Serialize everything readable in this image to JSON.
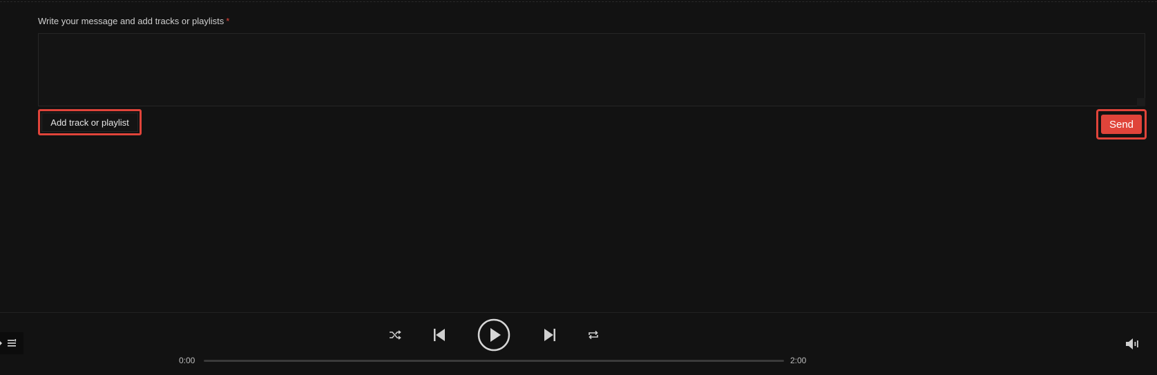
{
  "compose": {
    "label": "Write your message and add tracks or playlists",
    "required_mark": "*",
    "message_value": "",
    "add_button_label": "Add track or playlist",
    "send_button_label": "Send"
  },
  "player": {
    "current_time": "0:00",
    "duration": "2:00",
    "progress_fraction": 0,
    "icons": {
      "queue": "queue-list-icon",
      "shuffle": "shuffle-icon",
      "previous": "skip-previous-icon",
      "play": "play-icon",
      "next": "skip-next-icon",
      "repeat": "repeat-icon",
      "volume": "volume-icon"
    }
  },
  "colors": {
    "background": "#121212",
    "accent": "#e0443a",
    "text": "#cfcfcf"
  }
}
